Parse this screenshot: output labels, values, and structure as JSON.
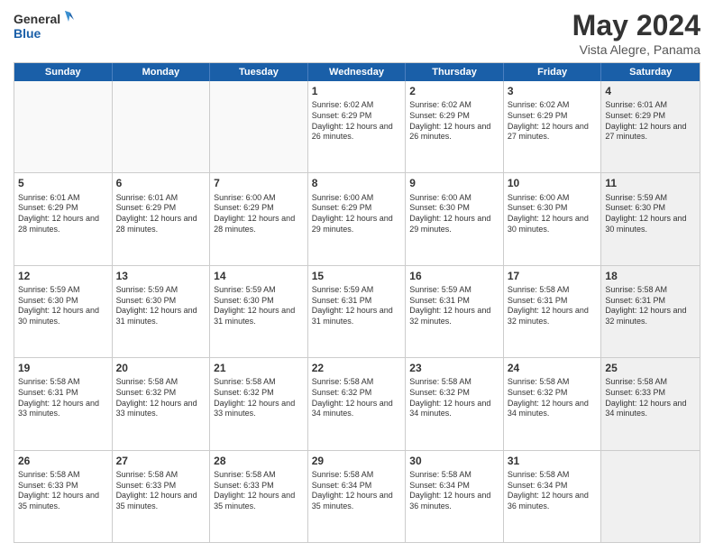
{
  "logo": {
    "line1": "General",
    "line2": "Blue"
  },
  "title": "May 2024",
  "location": "Vista Alegre, Panama",
  "weekdays": [
    "Sunday",
    "Monday",
    "Tuesday",
    "Wednesday",
    "Thursday",
    "Friday",
    "Saturday"
  ],
  "rows": [
    [
      {
        "day": "",
        "text": "",
        "empty": true
      },
      {
        "day": "",
        "text": "",
        "empty": true
      },
      {
        "day": "",
        "text": "",
        "empty": true
      },
      {
        "day": "1",
        "text": "Sunrise: 6:02 AM\nSunset: 6:29 PM\nDaylight: 12 hours\nand 26 minutes."
      },
      {
        "day": "2",
        "text": "Sunrise: 6:02 AM\nSunset: 6:29 PM\nDaylight: 12 hours\nand 26 minutes."
      },
      {
        "day": "3",
        "text": "Sunrise: 6:02 AM\nSunset: 6:29 PM\nDaylight: 12 hours\nand 27 minutes."
      },
      {
        "day": "4",
        "text": "Sunrise: 6:01 AM\nSunset: 6:29 PM\nDaylight: 12 hours\nand 27 minutes.",
        "shaded": true
      }
    ],
    [
      {
        "day": "5",
        "text": "Sunrise: 6:01 AM\nSunset: 6:29 PM\nDaylight: 12 hours\nand 28 minutes."
      },
      {
        "day": "6",
        "text": "Sunrise: 6:01 AM\nSunset: 6:29 PM\nDaylight: 12 hours\nand 28 minutes."
      },
      {
        "day": "7",
        "text": "Sunrise: 6:00 AM\nSunset: 6:29 PM\nDaylight: 12 hours\nand 28 minutes."
      },
      {
        "day": "8",
        "text": "Sunrise: 6:00 AM\nSunset: 6:29 PM\nDaylight: 12 hours\nand 29 minutes."
      },
      {
        "day": "9",
        "text": "Sunrise: 6:00 AM\nSunset: 6:30 PM\nDaylight: 12 hours\nand 29 minutes."
      },
      {
        "day": "10",
        "text": "Sunrise: 6:00 AM\nSunset: 6:30 PM\nDaylight: 12 hours\nand 30 minutes."
      },
      {
        "day": "11",
        "text": "Sunrise: 5:59 AM\nSunset: 6:30 PM\nDaylight: 12 hours\nand 30 minutes.",
        "shaded": true
      }
    ],
    [
      {
        "day": "12",
        "text": "Sunrise: 5:59 AM\nSunset: 6:30 PM\nDaylight: 12 hours\nand 30 minutes."
      },
      {
        "day": "13",
        "text": "Sunrise: 5:59 AM\nSunset: 6:30 PM\nDaylight: 12 hours\nand 31 minutes."
      },
      {
        "day": "14",
        "text": "Sunrise: 5:59 AM\nSunset: 6:30 PM\nDaylight: 12 hours\nand 31 minutes."
      },
      {
        "day": "15",
        "text": "Sunrise: 5:59 AM\nSunset: 6:31 PM\nDaylight: 12 hours\nand 31 minutes."
      },
      {
        "day": "16",
        "text": "Sunrise: 5:59 AM\nSunset: 6:31 PM\nDaylight: 12 hours\nand 32 minutes."
      },
      {
        "day": "17",
        "text": "Sunrise: 5:58 AM\nSunset: 6:31 PM\nDaylight: 12 hours\nand 32 minutes."
      },
      {
        "day": "18",
        "text": "Sunrise: 5:58 AM\nSunset: 6:31 PM\nDaylight: 12 hours\nand 32 minutes.",
        "shaded": true
      }
    ],
    [
      {
        "day": "19",
        "text": "Sunrise: 5:58 AM\nSunset: 6:31 PM\nDaylight: 12 hours\nand 33 minutes."
      },
      {
        "day": "20",
        "text": "Sunrise: 5:58 AM\nSunset: 6:32 PM\nDaylight: 12 hours\nand 33 minutes."
      },
      {
        "day": "21",
        "text": "Sunrise: 5:58 AM\nSunset: 6:32 PM\nDaylight: 12 hours\nand 33 minutes."
      },
      {
        "day": "22",
        "text": "Sunrise: 5:58 AM\nSunset: 6:32 PM\nDaylight: 12 hours\nand 34 minutes."
      },
      {
        "day": "23",
        "text": "Sunrise: 5:58 AM\nSunset: 6:32 PM\nDaylight: 12 hours\nand 34 minutes."
      },
      {
        "day": "24",
        "text": "Sunrise: 5:58 AM\nSunset: 6:32 PM\nDaylight: 12 hours\nand 34 minutes."
      },
      {
        "day": "25",
        "text": "Sunrise: 5:58 AM\nSunset: 6:33 PM\nDaylight: 12 hours\nand 34 minutes.",
        "shaded": true
      }
    ],
    [
      {
        "day": "26",
        "text": "Sunrise: 5:58 AM\nSunset: 6:33 PM\nDaylight: 12 hours\nand 35 minutes."
      },
      {
        "day": "27",
        "text": "Sunrise: 5:58 AM\nSunset: 6:33 PM\nDaylight: 12 hours\nand 35 minutes."
      },
      {
        "day": "28",
        "text": "Sunrise: 5:58 AM\nSunset: 6:33 PM\nDaylight: 12 hours\nand 35 minutes."
      },
      {
        "day": "29",
        "text": "Sunrise: 5:58 AM\nSunset: 6:34 PM\nDaylight: 12 hours\nand 35 minutes."
      },
      {
        "day": "30",
        "text": "Sunrise: 5:58 AM\nSunset: 6:34 PM\nDaylight: 12 hours\nand 36 minutes."
      },
      {
        "day": "31",
        "text": "Sunrise: 5:58 AM\nSunset: 6:34 PM\nDaylight: 12 hours\nand 36 minutes."
      },
      {
        "day": "",
        "text": "",
        "empty": true,
        "shaded": true
      }
    ]
  ]
}
